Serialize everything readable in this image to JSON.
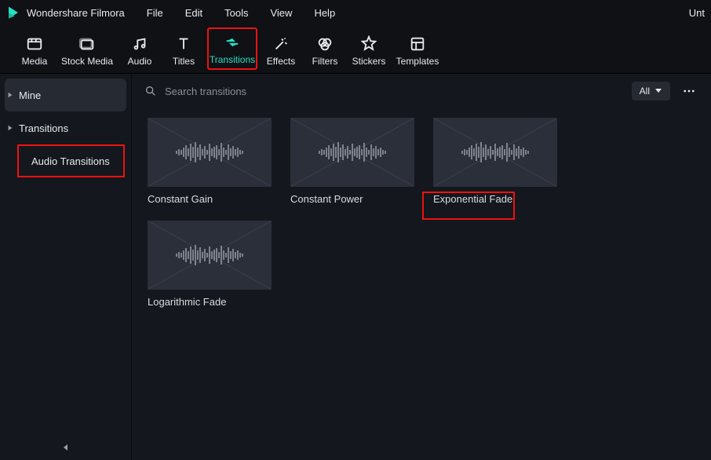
{
  "app": {
    "title": "Wondershare Filmora",
    "untitled": "Unt"
  },
  "menubar": {
    "items": [
      "File",
      "Edit",
      "Tools",
      "View",
      "Help"
    ]
  },
  "toolbar": {
    "tabs": [
      {
        "label": "Media",
        "icon": "media-icon"
      },
      {
        "label": "Stock Media",
        "icon": "stock-icon"
      },
      {
        "label": "Audio",
        "icon": "audio-icon"
      },
      {
        "label": "Titles",
        "icon": "titles-icon"
      },
      {
        "label": "Transitions",
        "icon": "transitions-icon",
        "active": true
      },
      {
        "label": "Effects",
        "icon": "effects-icon"
      },
      {
        "label": "Filters",
        "icon": "filters-icon"
      },
      {
        "label": "Stickers",
        "icon": "stickers-icon"
      },
      {
        "label": "Templates",
        "icon": "templates-icon"
      }
    ]
  },
  "sidebar": {
    "items": [
      {
        "label": "Mine"
      },
      {
        "label": "Transitions"
      },
      {
        "label": "Audio Transitions",
        "highlighted": true
      }
    ]
  },
  "search": {
    "placeholder": "Search transitions",
    "filter_label": "All"
  },
  "transitions": [
    {
      "label": "Constant Gain"
    },
    {
      "label": "Constant Power"
    },
    {
      "label": "Exponential Fade",
      "highlighted": true
    },
    {
      "label": "Logarithmic Fade"
    }
  ]
}
